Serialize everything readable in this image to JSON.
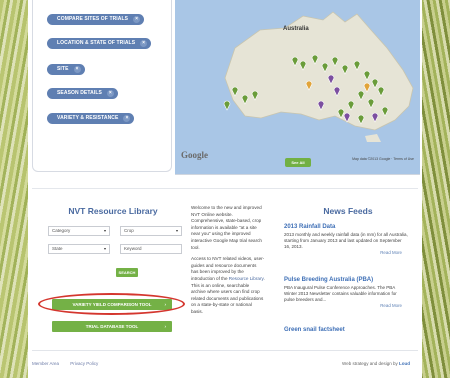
{
  "filters": [
    {
      "label": "COMPARE SITES OF TRIALS"
    },
    {
      "label": "LOCATION & STATE OF TRIALS"
    },
    {
      "label": "SITE"
    },
    {
      "label": "SEASON DETAILS"
    },
    {
      "label": "VARIETY & RESISTANCE"
    }
  ],
  "map": {
    "country_label": "Australia",
    "google_label": "Google",
    "map_data_text": "Map data ©2013 Google · Terms of Use",
    "see_all_label": "See All"
  },
  "library": {
    "title": "NVT Resource Library",
    "category_select": "Category",
    "crop_select": "Crop",
    "state_select": "State",
    "keyword_placeholder": "Keyword",
    "search_label": "SEARCH",
    "variety_button": "VARIETY YIELD COMPARISON TOOL",
    "trial_button": "TRIAL DATABASE TOOL"
  },
  "welcome": {
    "p1": "Welcome to the new and improved NVT Online website. Comprehensive, state-based, crop information is available \"at a site near you\" using the improved interactive Google Map trial search tool.",
    "p2_a": "Access to NVT related videos, user-guides and resource documents has been improved by the introduction of the ",
    "p2_link": "Resource Library",
    "p2_b": ". This is an online, searchable archive where users can find crop related documents and publications on a state-by-state or national basis."
  },
  "news": {
    "title": "News Feeds",
    "items": [
      {
        "heading": "2013 Rainfall Data",
        "text": "2013 monthly and weekly rainfall data (in mm) for all Australia, starting from January 2013 and last updated on September 16, 2013.",
        "more": "Read More"
      },
      {
        "heading": "Pulse Breeding Australia (PBA)",
        "text": "PBA Inaugural Pulse Conference Approaches. The PBA Winter 2013 Newsletter contains valuable information for pulse breeders and...",
        "more": "Read More"
      },
      {
        "heading": "Green snail factsheet",
        "text": "",
        "more": ""
      }
    ]
  },
  "footer": {
    "member_area": "Member Area",
    "privacy_policy": "Privacy Policy",
    "credit": "Web strategy and design by",
    "credit_logo": "Loud"
  },
  "colors": {
    "accent_blue": "#4a6aa0",
    "button_green": "#74b146",
    "highlight_red": "#d4362e"
  }
}
